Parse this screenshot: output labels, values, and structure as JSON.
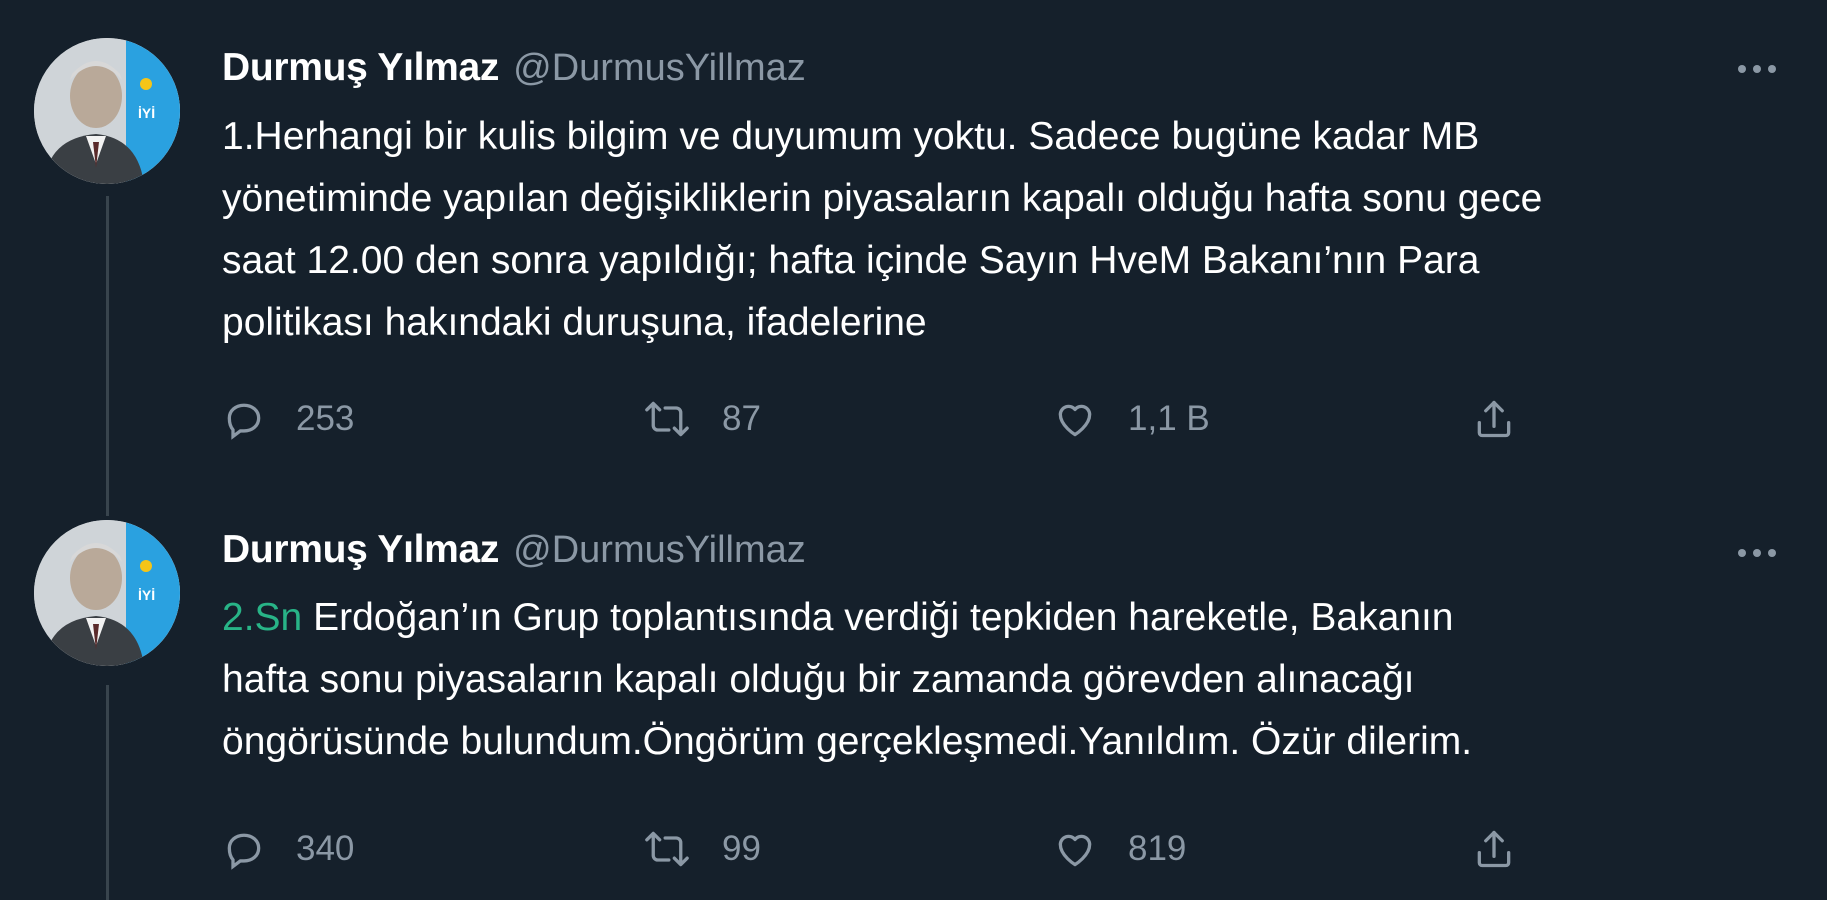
{
  "tweets": [
    {
      "display_name": "Durmuş Yılmaz",
      "handle": "@DurmusYillmaz",
      "text_prefix": "",
      "text": "1.Herhangi bir kulis bilgim ve duyumum yoktu. Sadece bugüne kadar MB\nyönetiminde yapılan değişikliklerin piyasaların kapalı olduğu hafta sonu gece\nsaat 12.00 den sonra yapıldığı; hafta içinde Sayın HveM Bakanı’nın Para\npolitikası hakındaki duruşuna, ifadelerine",
      "replies": "253",
      "retweets": "87",
      "likes": "1,1 B"
    },
    {
      "display_name": "Durmuş Yılmaz",
      "handle": "@DurmusYillmaz",
      "text_prefix": "2.Sn",
      "text": " Erdoğan’ın Grup toplantısında verdiği tepkiden hareketle,  Bakanın\nhafta sonu piyasaların kapalı olduğu bir zamanda görevden alınacağı\nöngörüsünde bulundum.Öngörüm gerçekleşmedi.Yanıldım. Özür dilerim.",
      "replies": "340",
      "retweets": "99",
      "likes": "819"
    }
  ],
  "icons": {
    "reply": "reply-icon",
    "retweet": "retweet-icon",
    "like": "heart-icon",
    "share": "share-icon",
    "more": "more-icon"
  },
  "colors": {
    "background": "#15202b",
    "secondary_text": "#8b98a5",
    "mention": "#28b487"
  }
}
